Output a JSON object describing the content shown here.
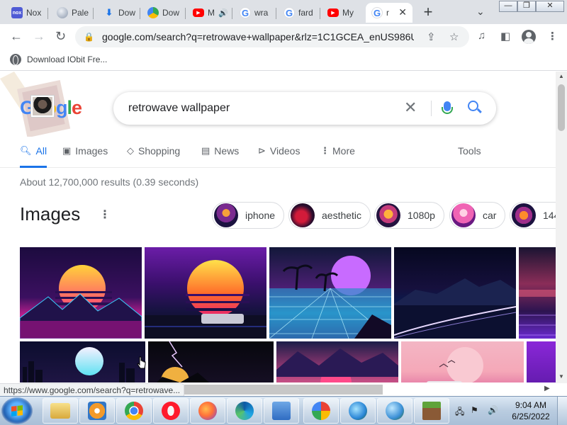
{
  "tabs": [
    {
      "label": "Nox",
      "icon": "nox-icon"
    },
    {
      "label": "Pale",
      "icon": "pale-moon-icon"
    },
    {
      "label": "Dow",
      "icon": "download-icon"
    },
    {
      "label": "Dow",
      "icon": "download-site-icon"
    },
    {
      "label": "M",
      "icon": "youtube-icon",
      "audio": true
    },
    {
      "label": "wra",
      "icon": "google-icon"
    },
    {
      "label": "fard",
      "icon": "google-icon"
    },
    {
      "label": "My",
      "icon": "youtube-icon"
    },
    {
      "label": "r",
      "icon": "google-icon",
      "active": true
    }
  ],
  "window_controls": {
    "minimize": "—",
    "maximize": "❐",
    "close": "✕"
  },
  "toolbar": {
    "url": "google.com/search?q=retrowave+wallpaper&rlz=1C1GCEA_enUS986U..."
  },
  "bookmarks": [
    {
      "label": "Download IObit Fre..."
    }
  ],
  "search": {
    "query": "retrowave wallpaper",
    "tabs": [
      {
        "label": "All",
        "icon": "search-icon",
        "active": true
      },
      {
        "label": "Images",
        "icon": "image-icon"
      },
      {
        "label": "Shopping",
        "icon": "tag-icon"
      },
      {
        "label": "News",
        "icon": "news-icon"
      },
      {
        "label": "Videos",
        "icon": "video-icon"
      },
      {
        "label": "More",
        "icon": "more-vert-icon"
      }
    ],
    "tools_label": "Tools",
    "stats": "About 12,700,000 results (0.39 seconds)",
    "images_heading": "Images",
    "chips": [
      {
        "label": "iphone"
      },
      {
        "label": "aesthetic"
      },
      {
        "label": "1080p"
      },
      {
        "label": "car"
      },
      {
        "label": "144"
      }
    ]
  },
  "status_url": "https://www.google.com/search?q=retrowave...",
  "taskbar": {
    "apps": [
      "file-explorer-icon",
      "media-player-icon",
      "chrome-icon",
      "opera-icon",
      "firefox-icon",
      "edge-icon",
      "control-panel-icon",
      "photos-icon",
      "network-icon",
      "network-settings-icon",
      "minecraft-icon"
    ],
    "clock_time": "9:04 AM",
    "clock_date": "6/25/2022"
  },
  "colors": {
    "accent": "#1a73e8",
    "tab_bar": "#dee1e6",
    "taskbar": "#b9cce0"
  }
}
